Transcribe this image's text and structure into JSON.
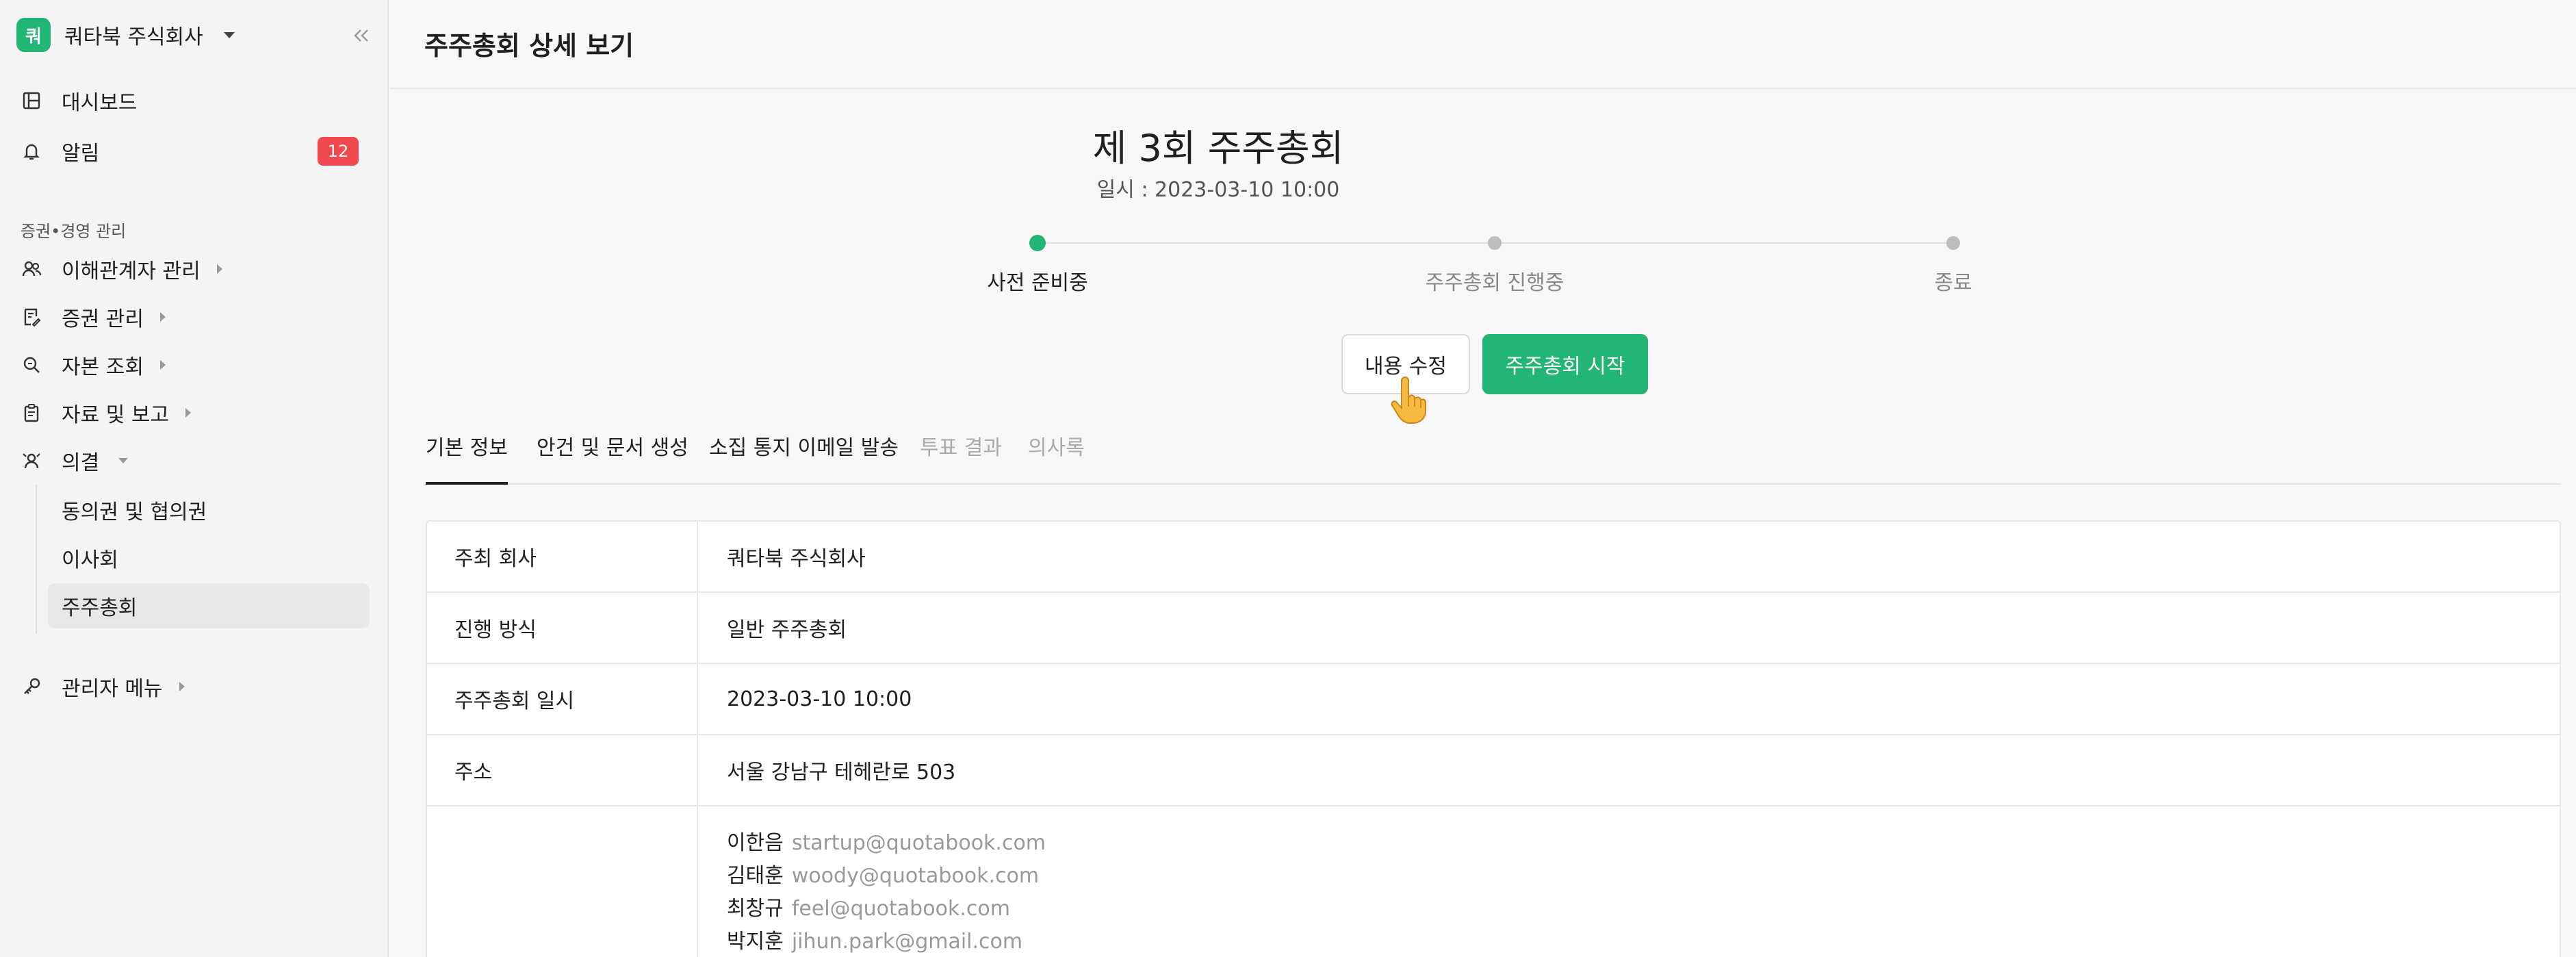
{
  "sidebar": {
    "company": {
      "logo_text": "쿼",
      "name": "쿼타북 주식회사"
    },
    "items": [
      {
        "label": "대시보드",
        "icon": "dashboard-icon"
      },
      {
        "label": "알림",
        "icon": "bell-icon",
        "badge": "12"
      }
    ],
    "section_label": "증권•경영 관리",
    "section_items": [
      {
        "label": "이해관계자 관리",
        "icon": "users-icon"
      },
      {
        "label": "증권 관리",
        "icon": "document-icon"
      },
      {
        "label": "자본 조회",
        "icon": "search-icon"
      },
      {
        "label": "자료 및 보고",
        "icon": "clipboard-icon"
      },
      {
        "label": "의결",
        "icon": "vote-icon"
      }
    ],
    "sub_items": [
      {
        "label": "동의권 및 협의권"
      },
      {
        "label": "이사회"
      },
      {
        "label": "주주총회",
        "active": true
      }
    ],
    "admin": {
      "label": "관리자 메뉴",
      "icon": "key-icon"
    }
  },
  "header": {
    "title": "주주총회 상세 보기"
  },
  "meeting": {
    "title": "제 3회 주주총회",
    "date": "일시 : 2023-03-10 10:00"
  },
  "steps": [
    {
      "label": "사전 준비중",
      "active": true
    },
    {
      "label": "주주총회 진행중",
      "active": false
    },
    {
      "label": "종료",
      "active": false
    }
  ],
  "actions": {
    "edit_label": "내용 수정",
    "start_label": "주주총회 시작"
  },
  "tabs": [
    {
      "label": "기본 정보",
      "state": "active"
    },
    {
      "label": "안건 및 문서 생성",
      "state": "normal"
    },
    {
      "label": "소집 통지 이메일 발송",
      "state": "normal"
    },
    {
      "label": "투표 결과",
      "state": "disabled"
    },
    {
      "label": "의사록",
      "state": "disabled"
    }
  ],
  "info": {
    "rows": [
      {
        "label": "주최 회사",
        "value": "쿼타북 주식회사"
      },
      {
        "label": "진행 방식",
        "value": "일반 주주총회"
      },
      {
        "label": "주주총회 일시",
        "value": "2023-03-10 10:00"
      },
      {
        "label": "주소",
        "value": "서울 강남구 테헤란로 503"
      }
    ],
    "attendees": [
      {
        "name": "이한음",
        "email": "startup@quotabook.com"
      },
      {
        "name": "김태훈",
        "email": "woody@quotabook.com"
      },
      {
        "name": "최창규",
        "email": "feel@quotabook.com"
      },
      {
        "name": "박지훈",
        "email": "jihun.park@gmail.com"
      }
    ]
  },
  "colors": {
    "accent": "#22b573",
    "badge": "#f0494f"
  }
}
